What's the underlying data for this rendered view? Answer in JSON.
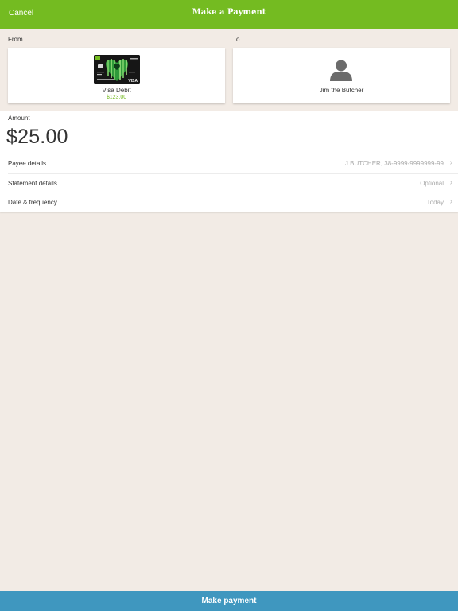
{
  "header": {
    "cancel_label": "Cancel",
    "title": "Make a Payment",
    "bar_color": "#74bb21"
  },
  "from": {
    "label": "From",
    "card_name": "Visa Debit",
    "card_balance": "$123.00",
    "card_brand": "VISA",
    "card_icon": "card-image-icon"
  },
  "to": {
    "label": "To",
    "payee_name": "Jim the Butcher",
    "payee_icon": "person-icon"
  },
  "amount": {
    "label": "Amount",
    "value": "$25.00"
  },
  "details": [
    {
      "label": "Payee details",
      "value": "J BUTCHER, 38-9999-9999999-99"
    },
    {
      "label": "Statement details",
      "value": "Optional"
    },
    {
      "label": "Date & frequency",
      "value": "Today"
    }
  ],
  "footer": {
    "submit_label": "Make payment",
    "button_color": "#3f97bf"
  }
}
